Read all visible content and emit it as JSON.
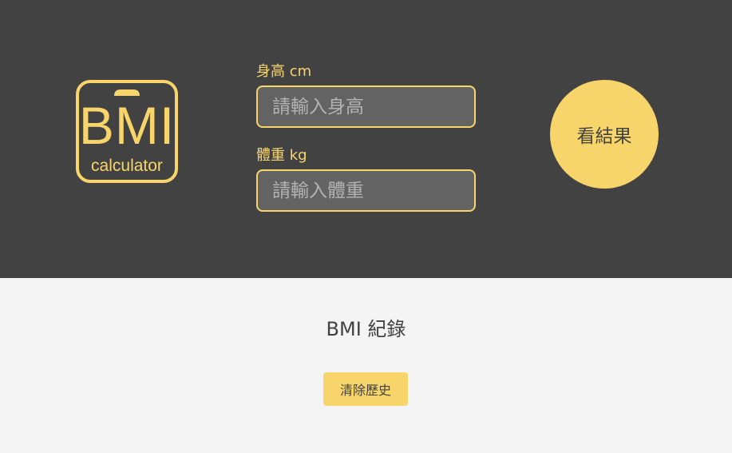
{
  "logo": {
    "icon": "bmi-scale-icon",
    "title": "BMI",
    "subtitle": "calculator"
  },
  "form": {
    "height": {
      "label": "身高 cm",
      "placeholder": "請輸入身高",
      "value": ""
    },
    "weight": {
      "label": "體重 kg",
      "placeholder": "請輸入體重",
      "value": ""
    },
    "submit_label": "看結果"
  },
  "records": {
    "title": "BMI 紀錄",
    "clear_label": "清除歷史"
  },
  "colors": {
    "accent": "#f8d56b",
    "header_background": "#424242",
    "input_background": "#636363",
    "page_background": "#f4f4f4"
  }
}
